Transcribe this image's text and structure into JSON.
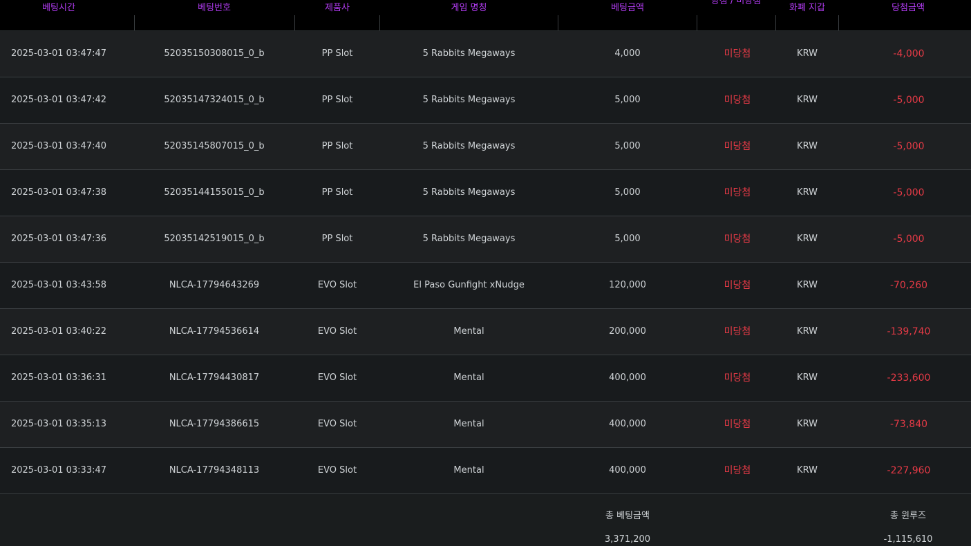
{
  "headers": {
    "time": "베팅시간",
    "bet_no": "베팅번호",
    "provider": "제품사",
    "game": "게임 명칭",
    "amount": "베팅금액",
    "result": "당첨 / 미당첨",
    "wallet": "화폐 지갑",
    "win_amount": "당첨금액"
  },
  "rows": [
    {
      "time": "2025-03-01 03:47:47",
      "bet_no": "52035150308015_0_b",
      "provider": "PP Slot",
      "game": "5 Rabbits Megaways",
      "amount": "4,000",
      "result": "미당첨",
      "wallet": "KRW",
      "win_amount": "-4,000"
    },
    {
      "time": "2025-03-01 03:47:42",
      "bet_no": "52035147324015_0_b",
      "provider": "PP Slot",
      "game": "5 Rabbits Megaways",
      "amount": "5,000",
      "result": "미당첨",
      "wallet": "KRW",
      "win_amount": "-5,000"
    },
    {
      "time": "2025-03-01 03:47:40",
      "bet_no": "52035145807015_0_b",
      "provider": "PP Slot",
      "game": "5 Rabbits Megaways",
      "amount": "5,000",
      "result": "미당첨",
      "wallet": "KRW",
      "win_amount": "-5,000"
    },
    {
      "time": "2025-03-01 03:47:38",
      "bet_no": "52035144155015_0_b",
      "provider": "PP Slot",
      "game": "5 Rabbits Megaways",
      "amount": "5,000",
      "result": "미당첨",
      "wallet": "KRW",
      "win_amount": "-5,000"
    },
    {
      "time": "2025-03-01 03:47:36",
      "bet_no": "52035142519015_0_b",
      "provider": "PP Slot",
      "game": "5 Rabbits Megaways",
      "amount": "5,000",
      "result": "미당첨",
      "wallet": "KRW",
      "win_amount": "-5,000"
    },
    {
      "time": "2025-03-01 03:43:58",
      "bet_no": "NLCA-17794643269",
      "provider": "EVO Slot",
      "game": "El Paso Gunfight xNudge",
      "amount": "120,000",
      "result": "미당첨",
      "wallet": "KRW",
      "win_amount": "-70,260"
    },
    {
      "time": "2025-03-01 03:40:22",
      "bet_no": "NLCA-17794536614",
      "provider": "EVO Slot",
      "game": "Mental",
      "amount": "200,000",
      "result": "미당첨",
      "wallet": "KRW",
      "win_amount": "-139,740"
    },
    {
      "time": "2025-03-01 03:36:31",
      "bet_no": "NLCA-17794430817",
      "provider": "EVO Slot",
      "game": "Mental",
      "amount": "400,000",
      "result": "미당첨",
      "wallet": "KRW",
      "win_amount": "-233,600"
    },
    {
      "time": "2025-03-01 03:35:13",
      "bet_no": "NLCA-17794386615",
      "provider": "EVO Slot",
      "game": "Mental",
      "amount": "400,000",
      "result": "미당첨",
      "wallet": "KRW",
      "win_amount": "-73,840"
    },
    {
      "time": "2025-03-01 03:33:47",
      "bet_no": "NLCA-17794348113",
      "provider": "EVO Slot",
      "game": "Mental",
      "amount": "400,000",
      "result": "미당첨",
      "wallet": "KRW",
      "win_amount": "-227,960"
    }
  ],
  "footer": {
    "total_bet_label": "총 베팅금액",
    "total_bet_value": "3,371,200",
    "total_winloss_label": "총 윈루즈",
    "total_winloss_value": "-1,115,610"
  },
  "colors": {
    "header_text": "#b23cf2",
    "loss_text": "#e63a46",
    "header_bg": "#000000"
  }
}
